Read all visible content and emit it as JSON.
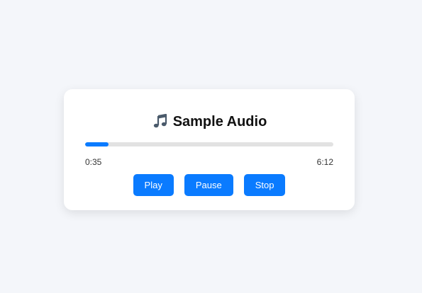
{
  "player": {
    "title": "Sample Audio",
    "title_icon": "music-note-icon",
    "current_time": "0:35",
    "total_time": "6:12",
    "progress_fraction": 0.094,
    "buttons": {
      "play": "Play",
      "pause": "Pause",
      "stop": "Stop"
    }
  },
  "colors": {
    "accent": "#0a7bff",
    "track": "#e2e2e2",
    "background": "#f4f6fa",
    "card": "#ffffff"
  }
}
